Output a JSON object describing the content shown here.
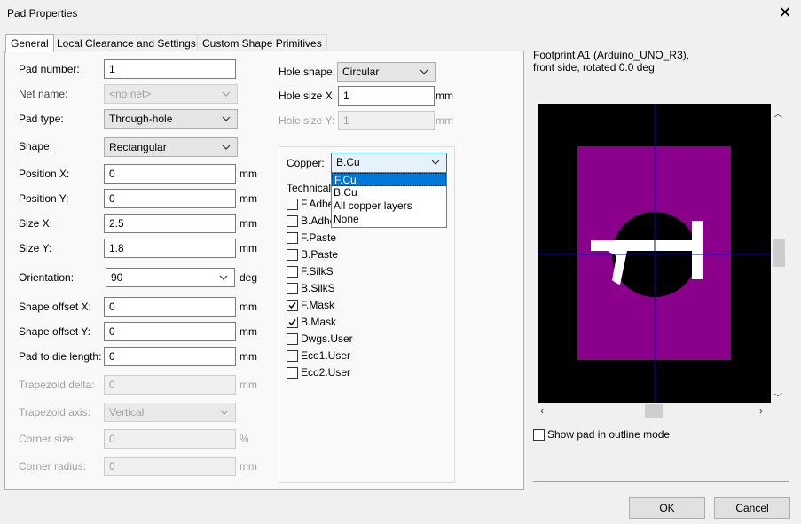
{
  "window": {
    "title": "Pad Properties"
  },
  "tabs": [
    "General",
    "Local Clearance and Settings",
    "Custom Shape Primitives"
  ],
  "fields": {
    "pad_number": {
      "label": "Pad number:",
      "value": "1"
    },
    "net_name": {
      "label": "Net name:",
      "value": "<no net>"
    },
    "pad_type": {
      "label": "Pad type:",
      "value": "Through-hole"
    },
    "shape": {
      "label": "Shape:",
      "value": "Rectangular"
    },
    "position_x": {
      "label": "Position X:",
      "value": "0",
      "unit": "mm"
    },
    "position_y": {
      "label": "Position Y:",
      "value": "0",
      "unit": "mm"
    },
    "size_x": {
      "label": "Size X:",
      "value": "2.5",
      "unit": "mm"
    },
    "size_y": {
      "label": "Size Y:",
      "value": "1.8",
      "unit": "mm"
    },
    "orientation": {
      "label": "Orientation:",
      "value": "90",
      "unit": "deg"
    },
    "shape_offset_x": {
      "label": "Shape offset X:",
      "value": "0",
      "unit": "mm"
    },
    "shape_offset_y": {
      "label": "Shape offset Y:",
      "value": "0",
      "unit": "mm"
    },
    "pad_to_die": {
      "label": "Pad to die length:",
      "value": "0",
      "unit": "mm"
    },
    "trapezoid_delta": {
      "label": "Trapezoid delta:",
      "value": "0",
      "unit": "mm"
    },
    "trapezoid_axis": {
      "label": "Trapezoid axis:",
      "value": "Vertical"
    },
    "corner_size": {
      "label": "Corner size:",
      "value": "0",
      "unit": "%"
    },
    "corner_radius": {
      "label": "Corner radius:",
      "value": "0",
      "unit": "mm"
    },
    "hole_shape": {
      "label": "Hole shape:",
      "value": "Circular"
    },
    "hole_size_x": {
      "label": "Hole size X:",
      "value": "1",
      "unit": "mm"
    },
    "hole_size_y": {
      "label": "Hole size Y:",
      "value": "1",
      "unit": "mm"
    }
  },
  "layers": {
    "copper_label": "Copper:",
    "copper_value": "B.Cu",
    "dropdown_options": [
      "F.Cu",
      "B.Cu",
      "All copper layers",
      "None"
    ],
    "technical_label": "Technical",
    "technical": [
      {
        "label": "F.Adhe",
        "checked": false
      },
      {
        "label": "B.Adhe",
        "checked": false
      },
      {
        "label": "F.Paste",
        "checked": false
      },
      {
        "label": "B.Paste",
        "checked": false
      },
      {
        "label": "F.SilkS",
        "checked": false
      },
      {
        "label": "B.SilkS",
        "checked": false
      },
      {
        "label": "F.Mask",
        "checked": true
      },
      {
        "label": "B.Mask",
        "checked": true
      },
      {
        "label": "Dwgs.User",
        "checked": false
      },
      {
        "label": "Eco1.User",
        "checked": false
      },
      {
        "label": "Eco2.User",
        "checked": false
      }
    ]
  },
  "preview": {
    "footprint_line1": "Footprint A1 (Arduino_UNO_R3),",
    "footprint_line2": "front side, rotated 0.0 deg",
    "outline_mode_label": "Show pad in outline mode",
    "colors": {
      "background": "#000000",
      "pad": "#8b008b",
      "crosshair": "#0000cc",
      "text": "#ffffff"
    }
  },
  "buttons": {
    "ok": "OK",
    "cancel": "Cancel"
  }
}
